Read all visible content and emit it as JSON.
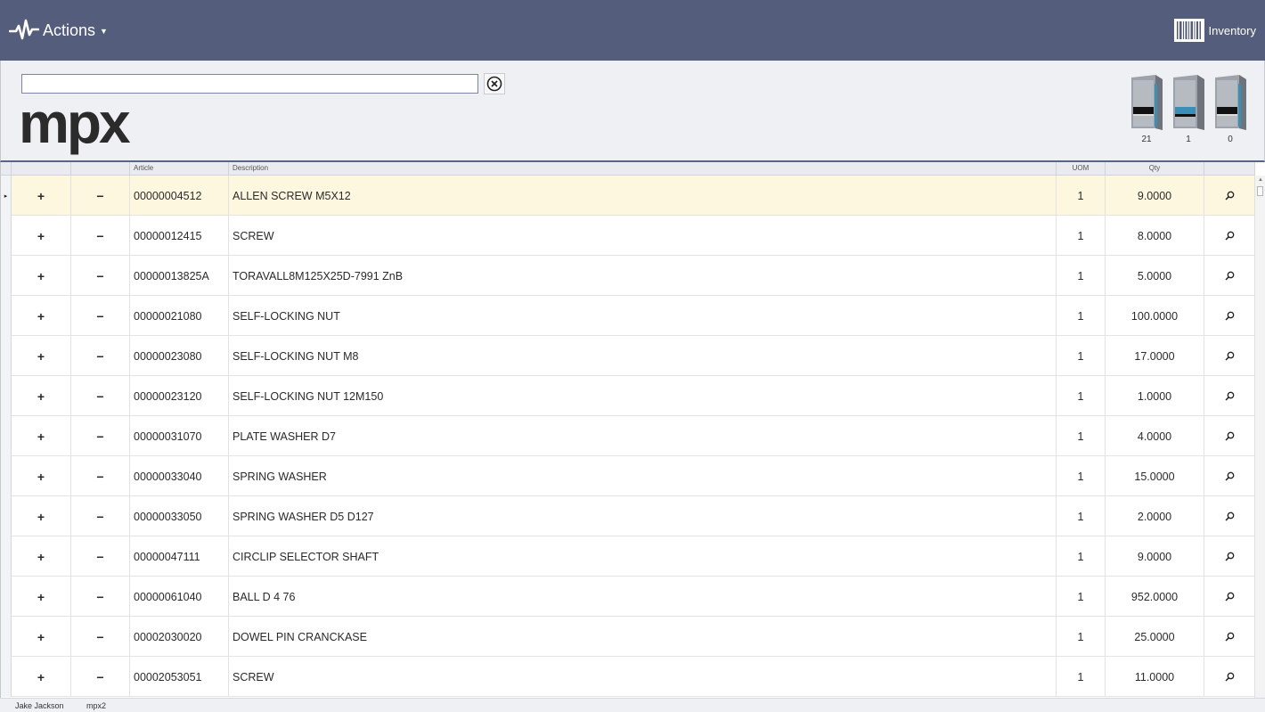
{
  "topbar": {
    "actions_label": "Actions",
    "inventory_label": "Inventory"
  },
  "search": {
    "value": "",
    "placeholder": ""
  },
  "logo": "mpx",
  "towers": [
    {
      "count": "21",
      "accent": "#3a8fb7"
    },
    {
      "count": "1",
      "accent": "#3a8fb7"
    },
    {
      "count": "0",
      "accent": "#3a8fb7"
    }
  ],
  "grid": {
    "columns": [
      "",
      "",
      "",
      "Article",
      "Description",
      "UOM",
      "Qty",
      ""
    ],
    "selected_row": 0,
    "rows": [
      {
        "plus": "+",
        "minus": "−",
        "article": "00000004512",
        "description": "ALLEN SCREW M5X12",
        "uom": "1",
        "qty": "9.0000"
      },
      {
        "plus": "+",
        "minus": "−",
        "article": "00000012415",
        "description": "SCREW",
        "uom": "1",
        "qty": "8.0000"
      },
      {
        "plus": "+",
        "minus": "−",
        "article": "00000013825A",
        "description": "TORAVALL8M125X25D-7991 ZnB",
        "uom": "1",
        "qty": "5.0000"
      },
      {
        "plus": "+",
        "minus": "−",
        "article": "00000021080",
        "description": "SELF-LOCKING NUT",
        "uom": "1",
        "qty": "100.0000"
      },
      {
        "plus": "+",
        "minus": "−",
        "article": "00000023080",
        "description": "SELF-LOCKING NUT M8",
        "uom": "1",
        "qty": "17.0000"
      },
      {
        "plus": "+",
        "minus": "−",
        "article": "00000023120",
        "description": "SELF-LOCKING NUT 12M150",
        "uom": "1",
        "qty": "1.0000"
      },
      {
        "plus": "+",
        "minus": "−",
        "article": "00000031070",
        "description": "PLATE WASHER D7",
        "uom": "1",
        "qty": "4.0000"
      },
      {
        "plus": "+",
        "minus": "−",
        "article": "00000033040",
        "description": "SPRING WASHER",
        "uom": "1",
        "qty": "15.0000"
      },
      {
        "plus": "+",
        "minus": "−",
        "article": "00000033050",
        "description": "SPRING WASHER D5 D127",
        "uom": "1",
        "qty": "2.0000"
      },
      {
        "plus": "+",
        "minus": "−",
        "article": "00000047111",
        "description": "CIRCLIP  SELECTOR SHAFT",
        "uom": "1",
        "qty": "9.0000"
      },
      {
        "plus": "+",
        "minus": "−",
        "article": "00000061040",
        "description": "BALL  D 4 76",
        "uom": "1",
        "qty": "952.0000"
      },
      {
        "plus": "+",
        "minus": "−",
        "article": "00002030020",
        "description": "DOWEL PIN  CRANCKASE",
        "uom": "1",
        "qty": "25.0000"
      },
      {
        "plus": "+",
        "minus": "−",
        "article": "00002053051",
        "description": "SCREW",
        "uom": "1",
        "qty": "11.0000"
      }
    ]
  },
  "status": {
    "user": "Jake Jackson",
    "host": "mpx2"
  },
  "colors": {
    "topbar": "#545e7c",
    "selected_row": "#fdf7e0"
  }
}
